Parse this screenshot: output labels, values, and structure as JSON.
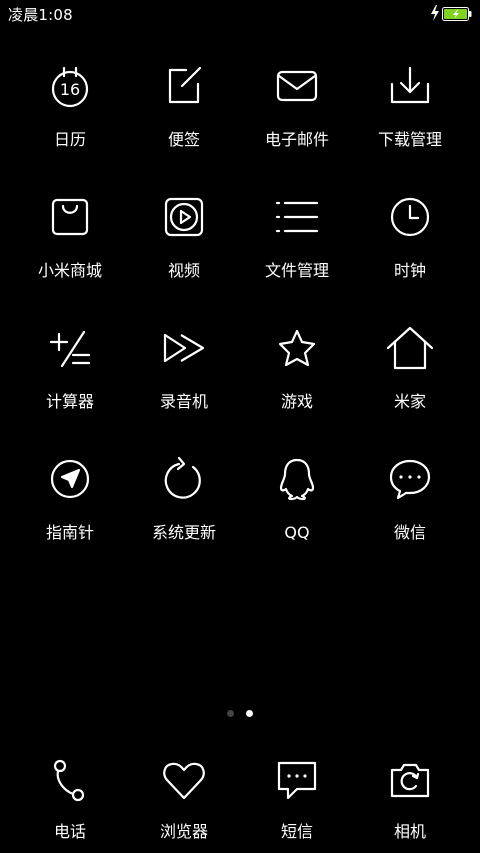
{
  "status_bar": {
    "time": "凌晨1:08",
    "battery_color": "#7ed321"
  },
  "apps": [
    {
      "label": "日历",
      "icon": "calendar-icon",
      "calendar_day": "16"
    },
    {
      "label": "便签",
      "icon": "notes-icon"
    },
    {
      "label": "电子邮件",
      "icon": "mail-icon"
    },
    {
      "label": "下载管理",
      "icon": "download-icon"
    },
    {
      "label": "小米商城",
      "icon": "shopping-bag-icon"
    },
    {
      "label": "视频",
      "icon": "video-icon"
    },
    {
      "label": "文件管理",
      "icon": "file-manager-icon"
    },
    {
      "label": "时钟",
      "icon": "clock-icon"
    },
    {
      "label": "计算器",
      "icon": "calculator-icon"
    },
    {
      "label": "录音机",
      "icon": "recorder-icon"
    },
    {
      "label": "游戏",
      "icon": "star-icon"
    },
    {
      "label": "米家",
      "icon": "home-icon"
    },
    {
      "label": "指南针",
      "icon": "compass-icon"
    },
    {
      "label": "系统更新",
      "icon": "update-icon"
    },
    {
      "label": "QQ",
      "icon": "qq-icon"
    },
    {
      "label": "微信",
      "icon": "wechat-icon"
    }
  ],
  "page_indicator": {
    "total": 2,
    "active": 2
  },
  "dock": [
    {
      "label": "电话",
      "icon": "phone-icon"
    },
    {
      "label": "浏览器",
      "icon": "heart-icon"
    },
    {
      "label": "短信",
      "icon": "message-icon"
    },
    {
      "label": "相机",
      "icon": "camera-icon"
    }
  ]
}
